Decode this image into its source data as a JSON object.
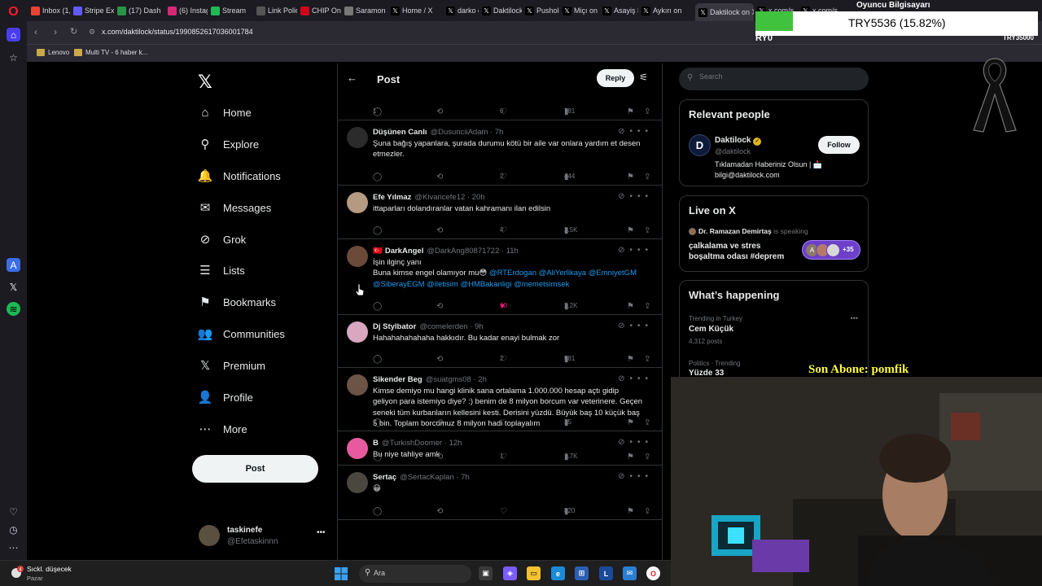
{
  "browser": {
    "tabs": [
      {
        "label": "Inbox (1,",
        "icon": "gmail-icon",
        "color": "#ea4335"
      },
      {
        "label": "Stripe Ex",
        "icon": "stripe-icon",
        "color": "#635bff"
      },
      {
        "label": "(17) Dash",
        "icon": "dashboard-icon",
        "color": "#2b9348"
      },
      {
        "label": "(6) Instag",
        "icon": "instagram-icon",
        "color": "#d62976"
      },
      {
        "label": "Stream",
        "icon": "stream-icon",
        "color": "#20b954"
      },
      {
        "label": "Link Polic",
        "icon": "link-icon",
        "color": "#555555"
      },
      {
        "label": "CHIP Onl",
        "icon": "chip-icon",
        "color": "#d0021b"
      },
      {
        "label": "Saramon",
        "icon": "page-icon",
        "color": "#777777"
      },
      {
        "label": "Home / X",
        "icon": "x-icon",
        "color": "#000000"
      },
      {
        "label": "darko on",
        "icon": "x-icon",
        "color": "#000000"
      },
      {
        "label": "Daktilock",
        "icon": "x-icon",
        "color": "#000000"
      },
      {
        "label": "Pusholde",
        "icon": "x-icon",
        "color": "#000000"
      },
      {
        "label": "Miçı on X",
        "icon": "x-icon",
        "color": "#000000"
      },
      {
        "label": "Asayiş Be",
        "icon": "x-icon",
        "color": "#000000"
      },
      {
        "label": "Aykırı on",
        "icon": "x-icon",
        "color": "#000000"
      },
      {
        "label": "Daktilock on X:",
        "icon": "x-icon",
        "color": "#000000",
        "active": true
      },
      {
        "label": "x.com/s",
        "icon": "x-icon",
        "color": "#000000"
      },
      {
        "label": "x.com/s",
        "icon": "x-icon",
        "color": "#000000"
      }
    ],
    "url": "x.com/daktilock/status/1990852617036001784",
    "bookmarks": [
      "Lenovo",
      "Multi TV - 6 haber k..."
    ]
  },
  "overlay": {
    "title": "Oyuncu Bilgisayarı",
    "price": "TRY5536 (15.82%)",
    "price_left": "RY0",
    "price_right": "TRY35000",
    "abone": "Son Abone: pomfik"
  },
  "nav": {
    "items": [
      {
        "label": "Home",
        "icon": "home-icon",
        "glyph": "⌂"
      },
      {
        "label": "Explore",
        "icon": "search-icon",
        "glyph": "⚲"
      },
      {
        "label": "Notifications",
        "icon": "bell-icon",
        "glyph": "🔔"
      },
      {
        "label": "Messages",
        "icon": "envelope-icon",
        "glyph": "✉"
      },
      {
        "label": "Grok",
        "icon": "grok-icon",
        "glyph": "⊘"
      },
      {
        "label": "Lists",
        "icon": "list-icon",
        "glyph": "☰"
      },
      {
        "label": "Bookmarks",
        "icon": "bookmark-icon",
        "glyph": "⚑"
      },
      {
        "label": "Communities",
        "icon": "communities-icon",
        "glyph": "👥"
      },
      {
        "label": "Premium",
        "icon": "x-premium-icon",
        "glyph": "𝕏"
      },
      {
        "label": "Profile",
        "icon": "person-icon",
        "glyph": "👤"
      },
      {
        "label": "More",
        "icon": "more-circle-icon",
        "glyph": "⋯"
      }
    ],
    "post_label": "Post",
    "account": {
      "name": "taskinefe",
      "handle": "@Efetaskinnn"
    }
  },
  "main": {
    "title": "Post",
    "reply_label": "Reply",
    "tweets": [
      {
        "partial": true,
        "reply": "1",
        "repost": "",
        "like": "6",
        "views": "781"
      },
      {
        "name": "Düşünen Canlı",
        "handle": "@DusunciiAdam",
        "time": "7h",
        "flag": "",
        "lines": [
          "Şuna bağış yapanlara, şurada durumu kötü bir aile var onlara yardım et desen",
          "etmezler."
        ],
        "mentions": [],
        "reply": "",
        "repost": "",
        "like": "2",
        "views": "444",
        "liked": false
      },
      {
        "name": "Efe Yılmaz",
        "handle": "@Kivancefe12",
        "time": "20h",
        "flag": "",
        "lines": [
          "ittaparları dolandıranlar vatan kahramanı ilan edilsin"
        ],
        "mentions": [],
        "reply": "",
        "repost": "",
        "like": "4",
        "views": "2.5K",
        "liked": false
      },
      {
        "name": "DarkAngel",
        "handle": "@DarkAng80871722",
        "time": "11h",
        "flag": "🇹🇷",
        "lines": [
          "İşin ilginç yanı",
          "Buna kimse engel olamıyor mu😳 "
        ],
        "mentions": [
          "@RTErdogan",
          "@AliYerlikaya",
          "@EmniyetGM",
          "@SiberayEGM",
          "@iletisim",
          "@HMBakanligi",
          "@memetsimsek"
        ],
        "reply": "",
        "repost": "",
        "like": "10",
        "views": "2.2K",
        "liked": true
      },
      {
        "name": "Dj Stylbator",
        "handle": "@comelerden",
        "time": "9h",
        "flag": "",
        "lines": [
          "Hahahahahahaha hakkıdır. Bu kadar enayi bulmak zor"
        ],
        "mentions": [],
        "reply": "",
        "repost": "",
        "like": "2",
        "views": "581",
        "liked": false
      },
      {
        "name": "Sikender Beg",
        "handle": "@suatgms08",
        "time": "2h",
        "flag": "",
        "lines": [
          "Kimse demiyo mu hangi klinik sana ortalama 1.000.000 hesap açtı gidip",
          "geliyon para istemiyo diye? :) benim de 8 milyon borcum var veterinere. Geçen",
          "seneki tüm kurbanların kellesini kesti. Derisini yüzdü. Büyük baş 10 küçük baş",
          "5 bin. Toplam borcumuz 8 milyon hadi toplayalım"
        ],
        "mentions": [],
        "reply": "1",
        "repost": "",
        "like": "",
        "views": "35",
        "liked": false
      },
      {
        "name": "B",
        "handle": "@TurkishDoomer",
        "time": "12h",
        "flag": "",
        "lines": [
          "Bu niye tahliye amk"
        ],
        "mentions": [],
        "reply": "",
        "repost": "",
        "like": "1",
        "views": "1.7K",
        "liked": false
      },
      {
        "name": "Sertaç",
        "handle": "@SertacKaplan",
        "time": "7h",
        "flag": "",
        "lines": [
          "😀"
        ],
        "mentions": [],
        "reply": "",
        "repost": "",
        "like": "",
        "views": "820",
        "liked": false
      }
    ]
  },
  "right": {
    "search_placeholder": "Search",
    "relevant": {
      "title": "Relevant people",
      "name": "Daktilock",
      "handle": "@daktilock",
      "bio": [
        "Tıklamadan Haberiniz Olsun | 📩",
        "bilgi@daktilock.com"
      ],
      "follow_label": "Follow"
    },
    "live": {
      "title": "Live on X",
      "host": "Dr. Ramazan Demirtaş",
      "host_suffix": "is speaking",
      "topic": [
        "çalkalama ve stres",
        "boşaltma odası #deprem"
      ],
      "count": "+35",
      "avatar_letter": "A"
    },
    "happening": {
      "title": "What’s happening",
      "trends": [
        {
          "meta": "Trending in Turkey",
          "name": "Cem Küçük",
          "posts": "4,312 posts"
        },
        {
          "meta": "Politics · Trending",
          "name": "Yüzde 33",
          "posts": ""
        }
      ]
    }
  },
  "taskbar": {
    "weather_title": "Sıckl. düşecek",
    "weather_sub": "Pazar",
    "weather_badge": "4",
    "search_label": "Ara"
  },
  "colors": {
    "accent": "#1d9bf0",
    "like": "#f91880",
    "bg": "#000000",
    "border": "#2f3336",
    "muted": "#71767b"
  }
}
